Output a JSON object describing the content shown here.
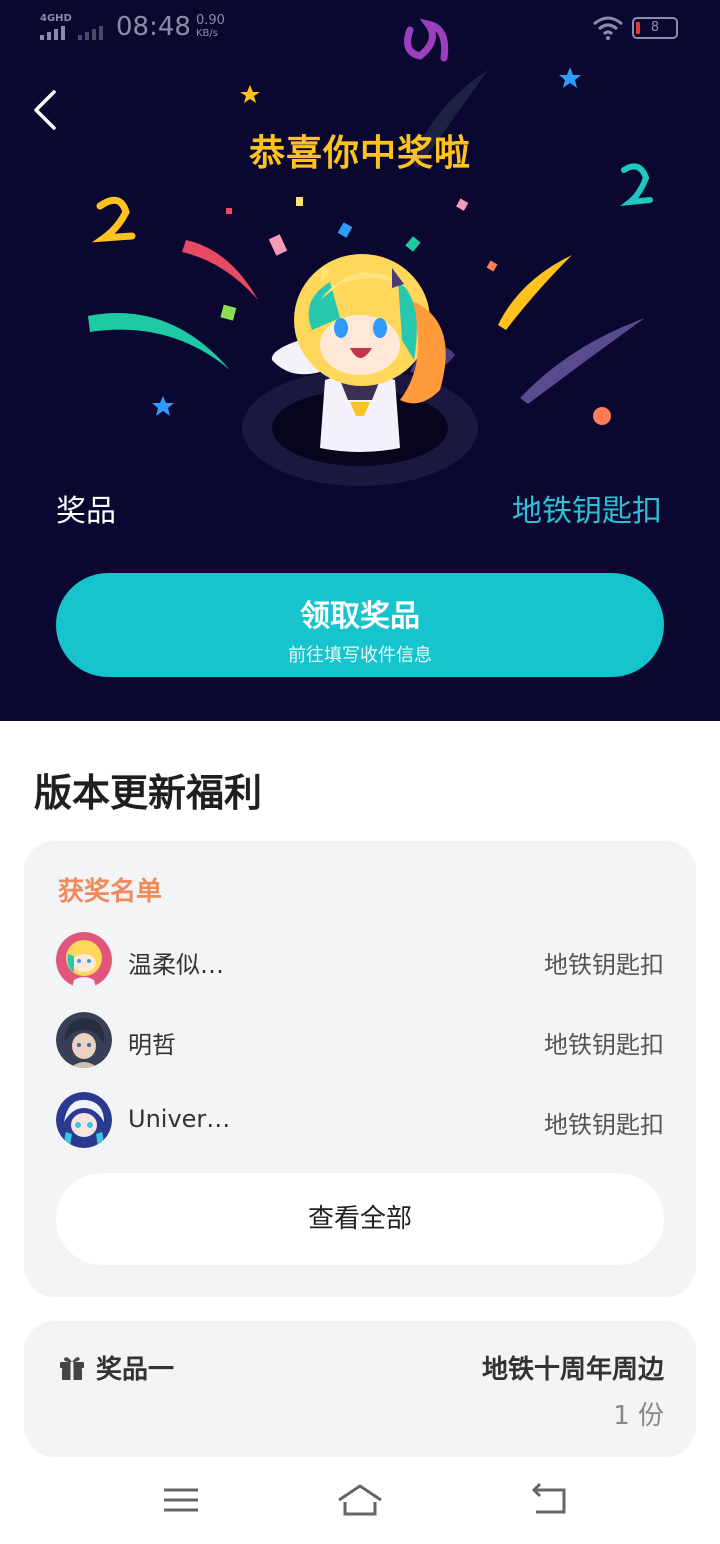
{
  "status_bar": {
    "network": "4GHD",
    "time": "08:48",
    "speed_value": "0.90",
    "speed_unit": "KB/s",
    "battery": "8"
  },
  "hero": {
    "title": "恭喜你中奖啦",
    "prize_label": "奖品",
    "prize_value": "地铁钥匙扣",
    "claim_button": {
      "title": "领取奖品",
      "subtitle": "前往填写收件信息"
    }
  },
  "section_title": "版本更新福利",
  "winners_card": {
    "title": "获奖名单",
    "winners": [
      {
        "name": "温柔似…",
        "prize": "地铁钥匙扣"
      },
      {
        "name": "明哲",
        "prize": "地铁钥匙扣"
      },
      {
        "name": "Univer…",
        "prize": "地铁钥匙扣"
      }
    ],
    "view_all": "查看全部"
  },
  "prize_card": {
    "label": "奖品一",
    "name": "地铁十周年周边",
    "count": "1 份"
  },
  "colors": {
    "hero_bg": "#0a0830",
    "accent": "#17c3cd",
    "title_gold": "#ffc21f",
    "winners_title": "#f08a5d"
  }
}
